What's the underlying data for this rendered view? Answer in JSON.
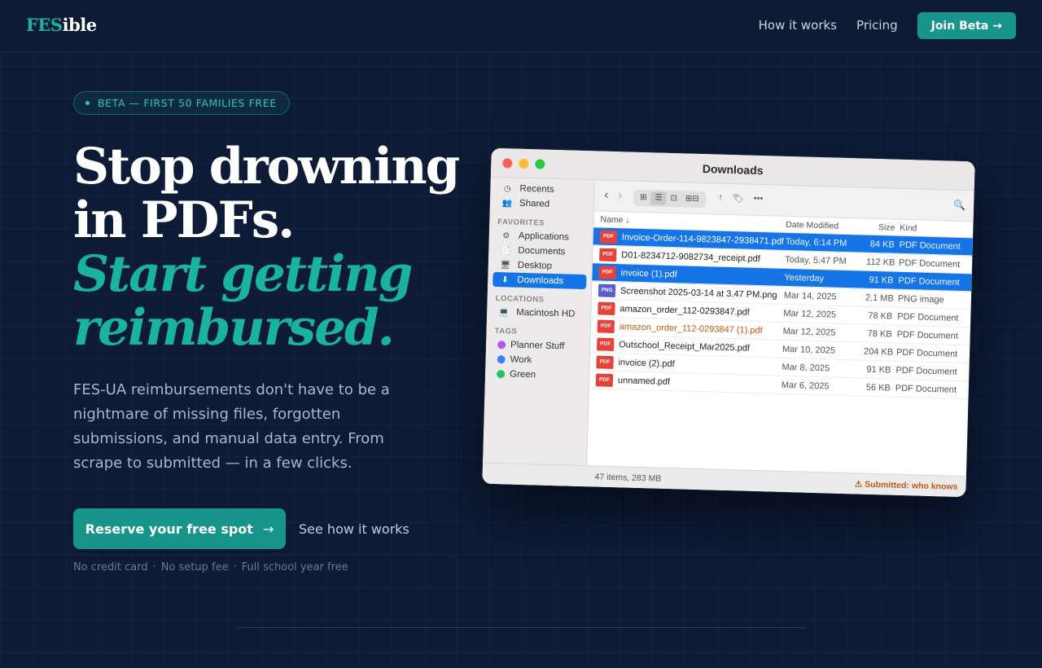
{
  "nav": {
    "logo_accent": "FES",
    "logo_rest": "ible",
    "links": [
      "How it works",
      "Pricing"
    ],
    "join_label": "Join Beta →"
  },
  "hero": {
    "badge": "BETA — FIRST 50 FAMILIES FREE",
    "title_line1": "Stop drowning",
    "title_line2": "in PDFs.",
    "title_accent1": "Start getting",
    "title_accent2": "reimbursed.",
    "lead": "FES-UA reimbursements don't have to be a nightmare of missing files, forgotten submissions, and manual data entry. From scrape to submitted — in a few clicks.",
    "cta_label": "Reserve your free spot",
    "cta_arrow": "→",
    "secondary_label": "See how it works",
    "fineprint": [
      "No credit card",
      "·",
      "No setup fee",
      "·",
      "Full school year free"
    ]
  },
  "finder": {
    "title": "Downloads",
    "sidebar": {
      "top": [
        {
          "icon": "clock-icon",
          "glyph": "◷",
          "label": "Recents"
        },
        {
          "icon": "shared-icon",
          "glyph": "👥",
          "label": "Shared"
        }
      ],
      "favorites_heading": "FAVORITES",
      "favorites": [
        {
          "icon": "applications-icon",
          "glyph": "⚙",
          "label": "Applications"
        },
        {
          "icon": "documents-icon",
          "glyph": "📄",
          "label": "Documents"
        },
        {
          "icon": "desktop-icon",
          "glyph": "🖥",
          "label": "Desktop"
        },
        {
          "icon": "downloads-icon",
          "glyph": "⬇",
          "label": "Downloads"
        }
      ],
      "locations_heading": "LOCATIONS",
      "locations": [
        {
          "icon": "harddisk-icon",
          "glyph": "💻",
          "label": "Macintosh HD"
        }
      ],
      "tags_heading": "TAGS",
      "tags": [
        {
          "label": "Planner Stuff",
          "color": "#b05bf0"
        },
        {
          "label": "Work",
          "color": "#3b82f6"
        },
        {
          "label": "Green",
          "color": "#22c55e"
        }
      ]
    },
    "columns": {
      "name": "Name ↓",
      "date": "Date Modified",
      "size": "Size",
      "kind": "Kind"
    },
    "files": [
      {
        "type": "PDF",
        "name": "Invoice-Order-114-9823847-2938471.pdf",
        "date": "Today, 6:14 PM",
        "size": "84 KB",
        "kind": "PDF Document",
        "selected": true
      },
      {
        "type": "PDF",
        "name": "D01-8234712-9082734_receipt.pdf",
        "date": "Today, 5:47 PM",
        "size": "112 KB",
        "kind": "PDF Document",
        "selected": false
      },
      {
        "type": "PDF",
        "name": "invoice (1).pdf",
        "date": "Yesterday",
        "size": "91 KB",
        "kind": "PDF Document",
        "selected": true
      },
      {
        "type": "PNG",
        "name": "Screenshot 2025-03-14 at 3.47 PM.png",
        "date": "Mar 14, 2025",
        "size": "2.1 MB",
        "kind": "PNG image",
        "selected": false
      },
      {
        "type": "PDF",
        "name": "amazon_order_112-0293847.pdf",
        "date": "Mar 12, 2025",
        "size": "78 KB",
        "kind": "PDF Document",
        "selected": false
      },
      {
        "type": "PDF",
        "name": "amazon_order_112-0293847 (1).pdf",
        "date": "Mar 12, 2025",
        "size": "78 KB",
        "kind": "PDF Document",
        "selected": false,
        "warn": true
      },
      {
        "type": "PDF",
        "name": "Outschool_Receipt_Mar2025.pdf",
        "date": "Mar 10, 2025",
        "size": "204 KB",
        "kind": "PDF Document",
        "selected": false
      },
      {
        "type": "PDF",
        "name": "invoice (2).pdf",
        "date": "Mar 8, 2025",
        "size": "91 KB",
        "kind": "PDF Document",
        "selected": false
      },
      {
        "type": "PDF",
        "name": "unnamed.pdf",
        "date": "Mar 6, 2025",
        "size": "56 KB",
        "kind": "PDF Document",
        "selected": false
      }
    ],
    "status_left": "47 items, 283 MB",
    "status_right": "⚠ Submitted: who knows"
  },
  "colors": {
    "background": "#0d1b36",
    "accent": "#19b3a0",
    "button": "#17958a",
    "selection": "#1675e6",
    "warning": "#c45a12"
  }
}
